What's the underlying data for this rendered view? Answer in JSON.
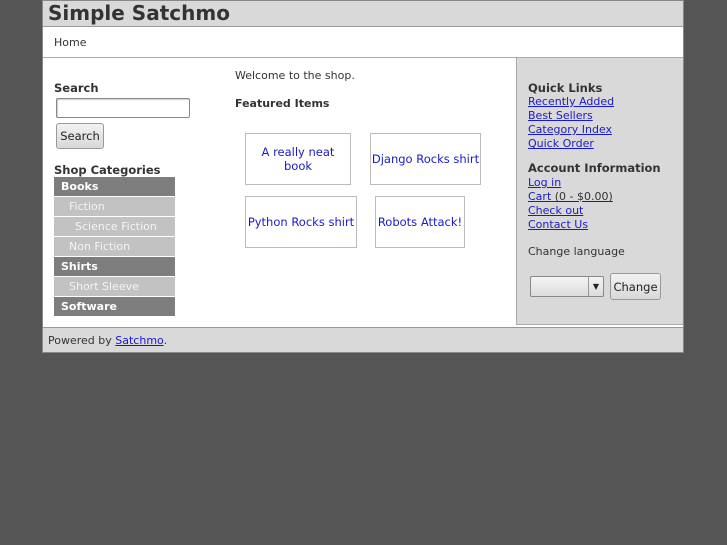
{
  "header": {
    "site_title": "Simple Satchmo"
  },
  "nav": {
    "home": "Home"
  },
  "search": {
    "heading": "Search",
    "input_value": "",
    "button_label": "Search"
  },
  "categories": {
    "heading": "Shop Categories",
    "items": [
      {
        "label": "Books",
        "level": 0
      },
      {
        "label": "Fiction",
        "level": 1
      },
      {
        "label": "Science Fiction",
        "level": 2
      },
      {
        "label": "Non Fiction",
        "level": 1
      },
      {
        "label": "Shirts",
        "level": 0
      },
      {
        "label": "Short Sleeve",
        "level": 1
      },
      {
        "label": "Software",
        "level": 0
      }
    ]
  },
  "main": {
    "welcome": "Welcome to the shop.",
    "featured_heading": "Featured Items",
    "products": [
      "A really neat book",
      "Django Rocks shirt",
      "Python Rocks shirt",
      "Robots Attack!"
    ]
  },
  "quick_links": {
    "heading": "Quick Links",
    "items": [
      "Recently Added",
      "Best Sellers",
      "Category Index",
      "Quick Order"
    ]
  },
  "account": {
    "heading": "Account Information",
    "login": "Log in",
    "cart": "Cart",
    "cart_summary": "(0 - $0.00)",
    "checkout": "Check out",
    "contact": "Contact Us"
  },
  "language": {
    "label": "Change language",
    "selected": "",
    "button_label": "Change"
  },
  "footer": {
    "prefix": "Powered by",
    "link": "Satchmo",
    "suffix": "."
  },
  "colors": {
    "background": "#555555",
    "header_bg": "#d9d9d9",
    "category_parent": "#7d7d7d",
    "category_child": "#c2c2c2",
    "link": "#1a1acc"
  }
}
